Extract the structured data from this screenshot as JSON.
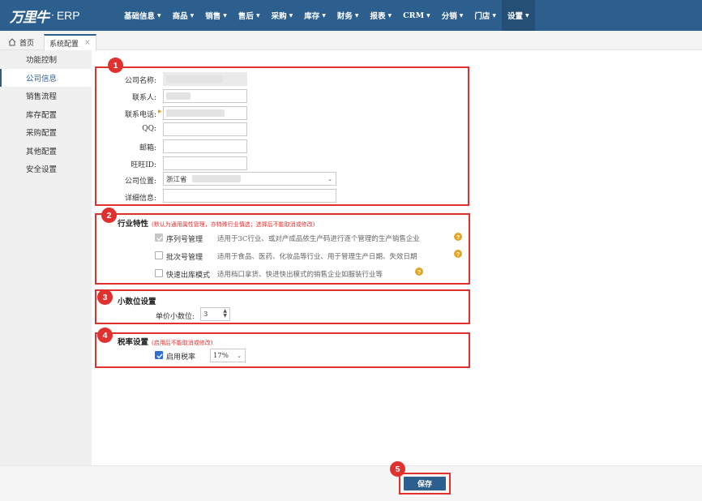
{
  "header": {
    "logo_text": "万里牛",
    "logo_suffix": "ERP",
    "menu": [
      {
        "label": "基础信息"
      },
      {
        "label": "商品"
      },
      {
        "label": "销售"
      },
      {
        "label": "售后"
      },
      {
        "label": "采购"
      },
      {
        "label": "库存"
      },
      {
        "label": "财务"
      },
      {
        "label": "报表"
      },
      {
        "label": "CRM"
      },
      {
        "label": "分销"
      },
      {
        "label": "门店"
      },
      {
        "label": "设置"
      }
    ]
  },
  "tabs": {
    "home_label": "首页",
    "current_label": "系统配置",
    "close_glyph": "×"
  },
  "sidebar": {
    "items": [
      {
        "label": "功能控制"
      },
      {
        "label": "公司信息"
      },
      {
        "label": "销售流程"
      },
      {
        "label": "库存配置"
      },
      {
        "label": "采购配置"
      },
      {
        "label": "其他配置"
      },
      {
        "label": "安全设置"
      }
    ]
  },
  "badges": [
    "1",
    "2",
    "3",
    "4",
    "5"
  ],
  "company": {
    "name_label": "公司名称:",
    "contact_label": "联系人:",
    "phone_label": "联系电话:",
    "qq_label": "QQ:",
    "email_label": "邮箱:",
    "wangwang_label": "旺旺ID:",
    "location_label": "公司位置:",
    "location_value": "浙江省",
    "detail_label": "详细信息:"
  },
  "industry": {
    "title": "行业特性",
    "note": "(默认为通用属性管理，亦特殊行业慎选；选择后不能取消或修改)",
    "options": [
      {
        "label": "序列号管理",
        "desc": "适用于3C行业、或对产成品依生产码进行逐个管理的生产销售企业",
        "checked": true
      },
      {
        "label": "批次号管理",
        "desc": "适用于食品、医药、化妆品等行业、用于管理生产日期、失效日期",
        "checked": false
      },
      {
        "label": "快速出库模式",
        "desc": "适用档口拿货、快进快出模式的销售企业如服装行业等",
        "checked": false
      }
    ],
    "help_glyph": "?"
  },
  "decimal": {
    "title": "小数位设置",
    "unit_price_label": "单价小数位:",
    "unit_price_value": "3"
  },
  "tax": {
    "title": "税率设置",
    "note": "(启用后不能取消或修改)",
    "enable_label": "启用税率",
    "enabled": true,
    "rate_value": "17%"
  },
  "footer": {
    "save_label": "保存"
  },
  "colors": {
    "nav": "#2c5f8e",
    "highlight": "#e0312f",
    "help": "#e3a422"
  }
}
